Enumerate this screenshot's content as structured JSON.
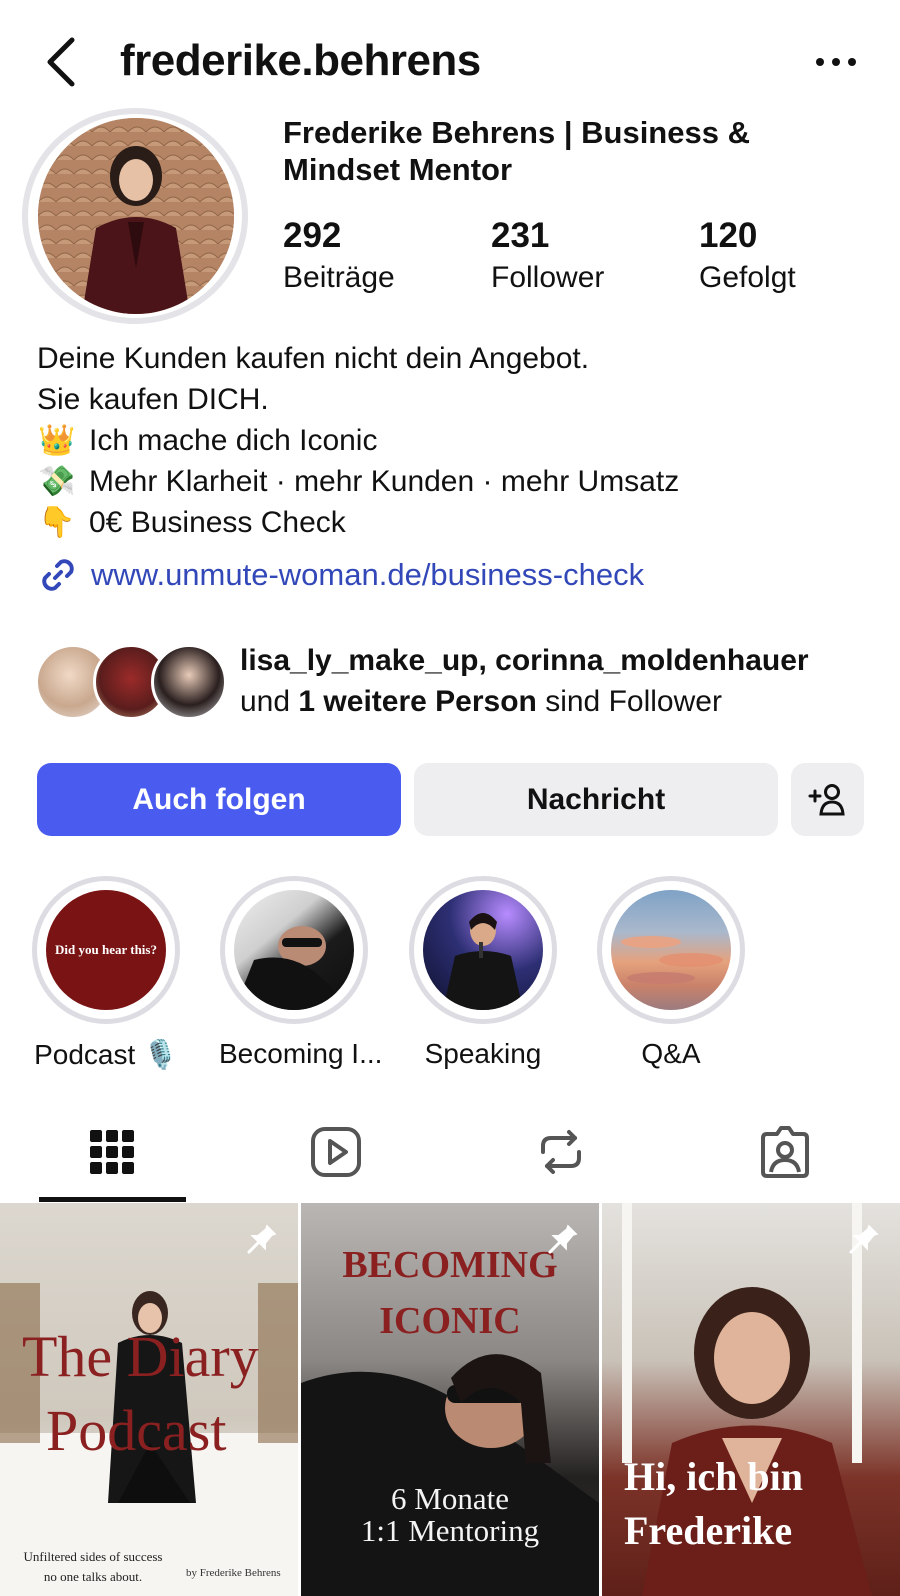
{
  "header": {
    "username": "frederike.behrens"
  },
  "profile": {
    "display_name": "Frederike Behrens | Business & Mindset Mentor",
    "stats": [
      {
        "value": "292",
        "label": "Beiträge"
      },
      {
        "value": "231",
        "label": "Follower"
      },
      {
        "value": "120",
        "label": "Gefolgt"
      }
    ],
    "bio_lines": [
      {
        "text": "Deine Kunden kaufen nicht dein Angebot."
      },
      {
        "text": "Sie kaufen DICH."
      },
      {
        "emoji": "👑",
        "text": "Ich mache dich Iconic"
      },
      {
        "emoji": "💸",
        "text": "Mehr Klarheit · mehr Kunden · mehr Umsatz"
      },
      {
        "emoji": "👇",
        "text": "0€ Business Check"
      }
    ],
    "link": "www.unmute-woman.de/business-check"
  },
  "followers": {
    "names": "lisa_ly_make_up, corinna_moldenhauer",
    "prefix": "und",
    "more": "1 weitere Person",
    "suffix": "sind Follower"
  },
  "actions": {
    "follow": "Auch folgen",
    "message": "Nachricht"
  },
  "highlights": [
    {
      "label": "Podcast 🎙️",
      "cover_text": "Did you hear this?"
    },
    {
      "label": "Becoming I..."
    },
    {
      "label": "Speaking"
    },
    {
      "label": "Q&A"
    }
  ],
  "posts": [
    {
      "title_line1": "The Diary",
      "title_line2": "Podcast",
      "footer_left_1": "Unfiltered sides of success",
      "footer_left_2": "no one talks about.",
      "footer_right": "by Frederike Behrens"
    },
    {
      "title_line1": "BECOMING",
      "title_line2": "ICONIC",
      "sub_line1": "6 Monate",
      "sub_line2": "1:1 Mentoring"
    },
    {
      "title_line1": "Hi, ich bin",
      "title_line2": "Frederike"
    }
  ],
  "colors": {
    "accent_blue": "#4a5cf0",
    "link_blue": "#3348b8",
    "button_grey": "#eeeef1",
    "podcast_red": "#7a1414"
  }
}
